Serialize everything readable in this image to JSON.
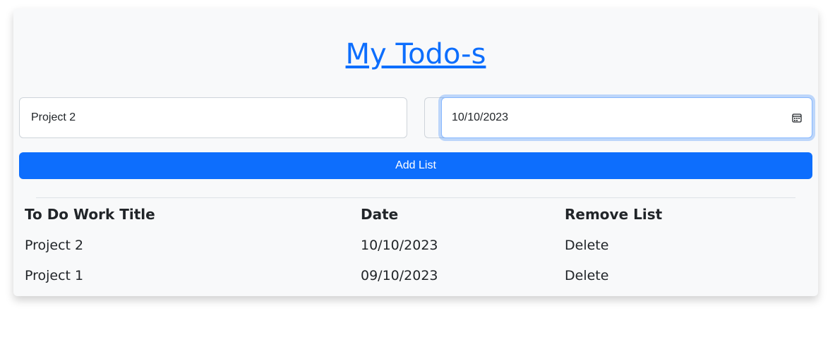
{
  "app": {
    "title": "My Todo-s"
  },
  "form": {
    "title_input_value": "Project 2",
    "date_input_value": "10/10/2023",
    "add_button_label": "Add List",
    "calendar_icon": "calendar-icon"
  },
  "table": {
    "headers": [
      "To Do Work Title",
      "Date",
      "Remove List"
    ],
    "rows": [
      {
        "title": "Project 2",
        "date": "10/10/2023",
        "action": "Delete"
      },
      {
        "title": "Project 1",
        "date": "09/10/2023",
        "action": "Delete"
      }
    ]
  },
  "colors": {
    "accent": "#0d6efd",
    "card_background": "#f8f9fa",
    "text": "#212529"
  }
}
